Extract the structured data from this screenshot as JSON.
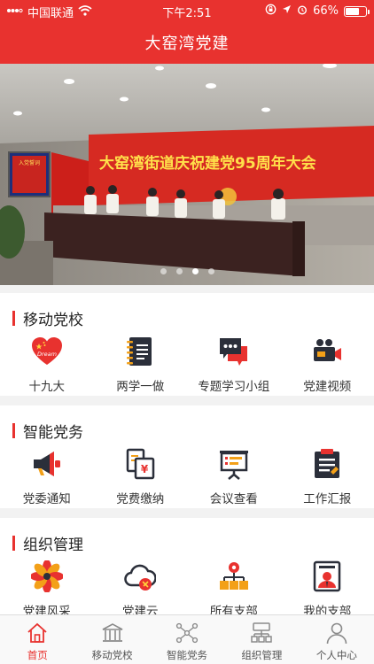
{
  "status_bar": {
    "carrier": "中国联通",
    "time": "下午2:51",
    "battery": "66%",
    "battery_level": 0.66
  },
  "header": {
    "title": "大窑湾党建"
  },
  "banner": {
    "slide_count": 4,
    "active_slide": 3,
    "photo_banner_text": "大窑湾街道庆祝建党95周年大会",
    "screen_text": "入党誓词"
  },
  "sections": [
    {
      "title": "移动党校",
      "items": [
        {
          "label": "十九大",
          "icon": "heart-flag-icon",
          "badge": "Dream"
        },
        {
          "label": "两学一做",
          "icon": "notebook-icon"
        },
        {
          "label": "专题学习小组",
          "icon": "chat-bubbles-icon"
        },
        {
          "label": "党建视频",
          "icon": "video-camera-icon"
        }
      ]
    },
    {
      "title": "智能党务",
      "items": [
        {
          "label": "党委通知",
          "icon": "megaphone-icon"
        },
        {
          "label": "党费缴纳",
          "icon": "fee-document-icon"
        },
        {
          "label": "会议查看",
          "icon": "presentation-board-icon"
        },
        {
          "label": "工作汇报",
          "icon": "report-clipboard-icon"
        }
      ]
    },
    {
      "title": "组织管理",
      "items": [
        {
          "label": "党建风采",
          "icon": "pinwheel-icon"
        },
        {
          "label": "党建云",
          "icon": "cloud-emblem-icon"
        },
        {
          "label": "所有支部",
          "icon": "org-tree-icon"
        },
        {
          "label": "我的支部",
          "icon": "member-card-icon"
        }
      ]
    }
  ],
  "tab_bar": [
    {
      "label": "首页",
      "icon": "home-icon",
      "active": true
    },
    {
      "label": "移动党校",
      "icon": "school-building-icon"
    },
    {
      "label": "智能党务",
      "icon": "network-nodes-icon"
    },
    {
      "label": "组织管理",
      "icon": "org-chart-icon"
    },
    {
      "label": "个人中心",
      "icon": "person-icon"
    }
  ],
  "colors": {
    "brand_red": "#e8322f",
    "icon_dark": "#2b2f3a",
    "icon_orange": "#f3a018",
    "tab_inactive": "#8a8a8a"
  }
}
